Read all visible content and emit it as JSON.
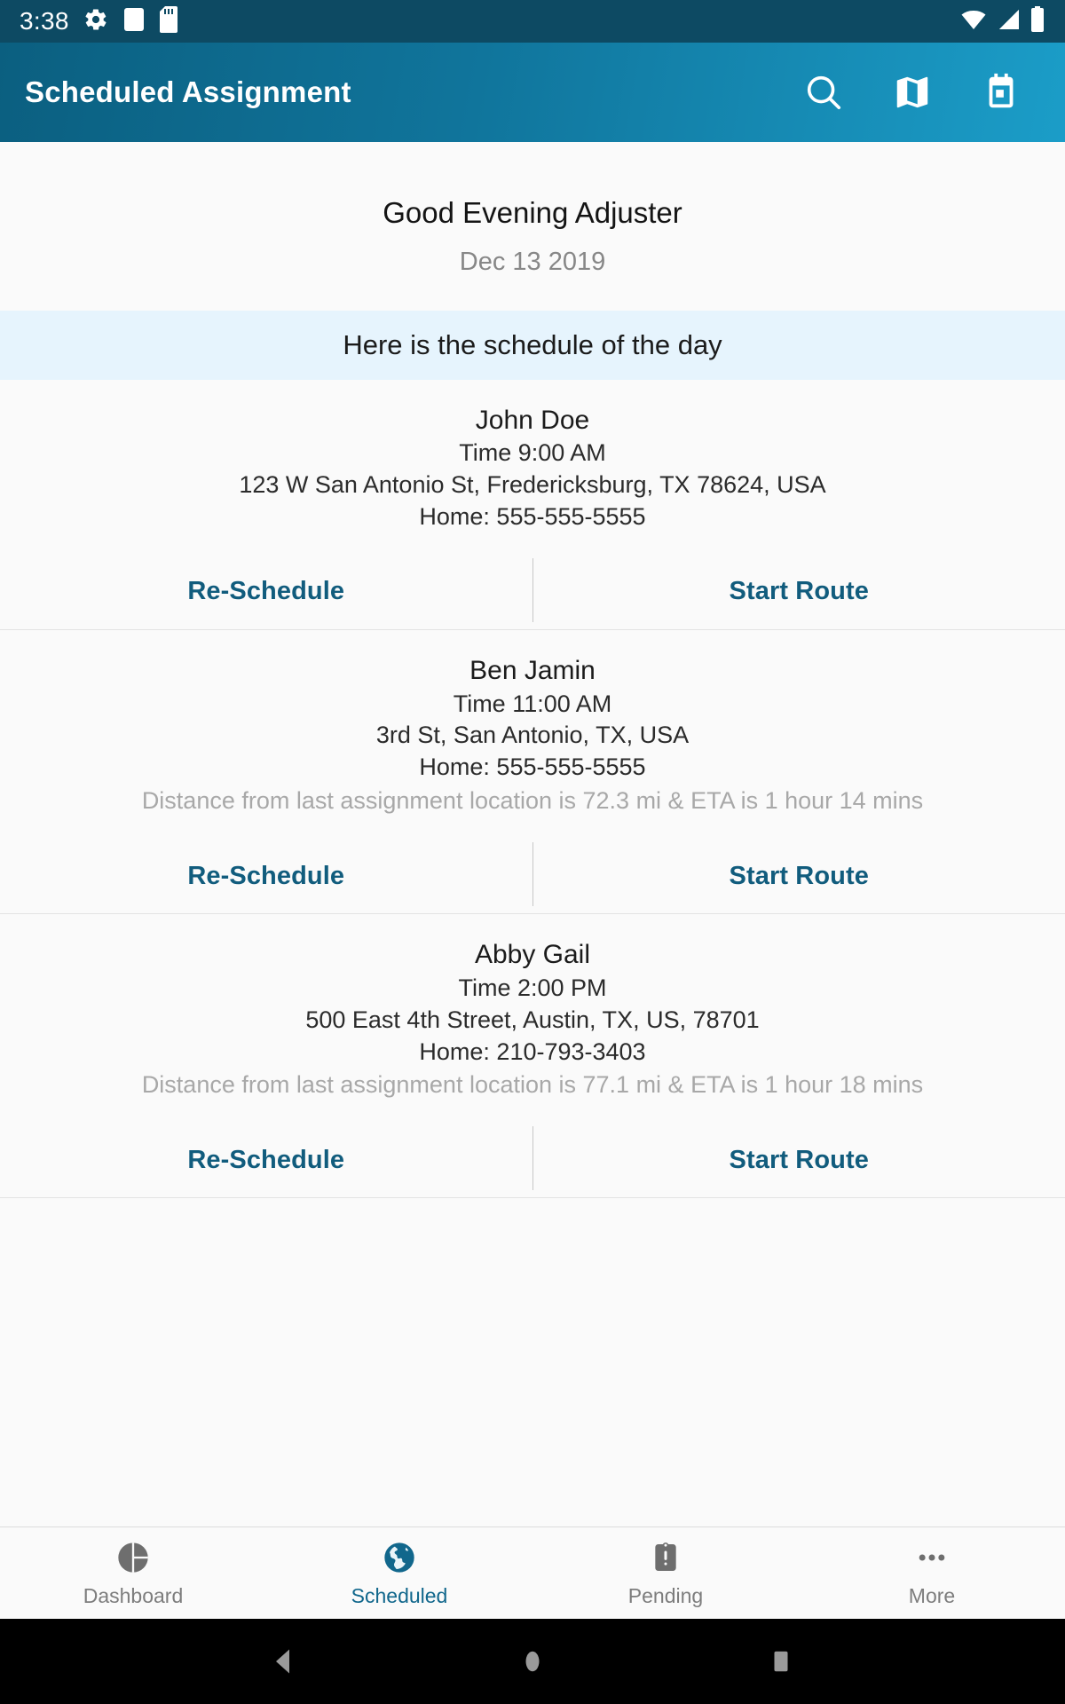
{
  "status_bar": {
    "time": "3:38",
    "left_icons": [
      "gear-icon",
      "white-square-icon",
      "sd-card-icon"
    ],
    "right_icons": [
      "wifi-icon",
      "cellular-signal-icon",
      "battery-icon"
    ]
  },
  "app_bar": {
    "title": "Scheduled Assignment",
    "actions": [
      {
        "name": "search-icon",
        "label": "Search"
      },
      {
        "name": "map-icon",
        "label": "Map"
      },
      {
        "name": "calendar-icon",
        "label": "Calendar"
      }
    ],
    "gradient_start": "#0b5f80",
    "gradient_end": "#1b9dc8"
  },
  "greeting": {
    "title": "Good Evening Adjuster",
    "date": "Dec 13 2019"
  },
  "banner": {
    "text": "Here is the schedule of the day",
    "background": "#e6f4fd"
  },
  "assignments": [
    {
      "name": "John Doe",
      "time": "Time 9:00 AM",
      "address": "123 W San Antonio St, Fredericksburg, TX 78624, USA",
      "phone": "Home: 555-555-5555",
      "distance": "",
      "reschedule_label": "Re-Schedule",
      "start_route_label": "Start Route"
    },
    {
      "name": "Ben Jamin",
      "time": "Time 11:00 AM",
      "address": "3rd St, San Antonio, TX, USA",
      "phone": "Home: 555-555-5555",
      "distance": "Distance from last assignment location is 72.3 mi & ETA is 1 hour 14 mins",
      "reschedule_label": "Re-Schedule",
      "start_route_label": "Start Route"
    },
    {
      "name": "Abby Gail",
      "time": "Time 2:00 PM",
      "address": "500 East 4th Street, Austin, TX, US, 78701",
      "phone": "Home: 210-793-3403",
      "distance": "Distance from last assignment location is 77.1 mi & ETA is 1 hour 18 mins",
      "reschedule_label": "Re-Schedule",
      "start_route_label": "Start Route"
    }
  ],
  "bottom_nav": {
    "active_color": "#11678c",
    "inactive_color": "#7d7d7d",
    "items": [
      {
        "label": "Dashboard",
        "icon": "pie-chart-icon",
        "active": false
      },
      {
        "label": "Scheduled",
        "icon": "globe-icon",
        "active": true
      },
      {
        "label": "Pending",
        "icon": "clipboard-alert-icon",
        "active": false
      },
      {
        "label": "More",
        "icon": "more-dots-icon",
        "active": false
      }
    ]
  },
  "system_nav": {
    "buttons": [
      {
        "name": "back-button",
        "icon": "triangle-left-icon"
      },
      {
        "name": "home-button",
        "icon": "circle-icon"
      },
      {
        "name": "recents-button",
        "icon": "square-icon"
      }
    ]
  },
  "link_color": "#115c7d"
}
